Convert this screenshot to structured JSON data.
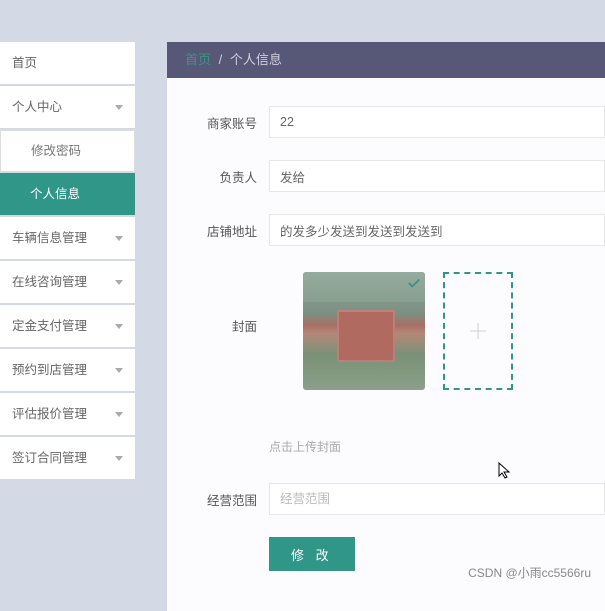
{
  "sidebar": {
    "items": [
      {
        "label": "首页",
        "expandable": false
      },
      {
        "label": "个人中心",
        "expandable": true
      },
      {
        "label": "修改密码",
        "sub": true
      },
      {
        "label": "个人信息",
        "sub": true,
        "active": true
      },
      {
        "label": "车辆信息管理",
        "expandable": true
      },
      {
        "label": "在线咨询管理",
        "expandable": true
      },
      {
        "label": "定金支付管理",
        "expandable": true
      },
      {
        "label": "预约到店管理",
        "expandable": true
      },
      {
        "label": "评估报价管理",
        "expandable": true
      },
      {
        "label": "签订合同管理",
        "expandable": true
      }
    ]
  },
  "breadcrumb": {
    "home": "首页",
    "current": "个人信息"
  },
  "form": {
    "account_label": "商家账号",
    "account_value": "22",
    "manager_label": "负责人",
    "manager_value": "发给",
    "address_label": "店铺地址",
    "address_value": "的发多少发送到发送到发送到",
    "cover_label": "封面",
    "upload_hint": "点击上传封面",
    "scope_label": "经营范围",
    "scope_placeholder": "经营范围",
    "submit_label": "修 改"
  },
  "watermark": "CSDN @小雨cc5566ru"
}
